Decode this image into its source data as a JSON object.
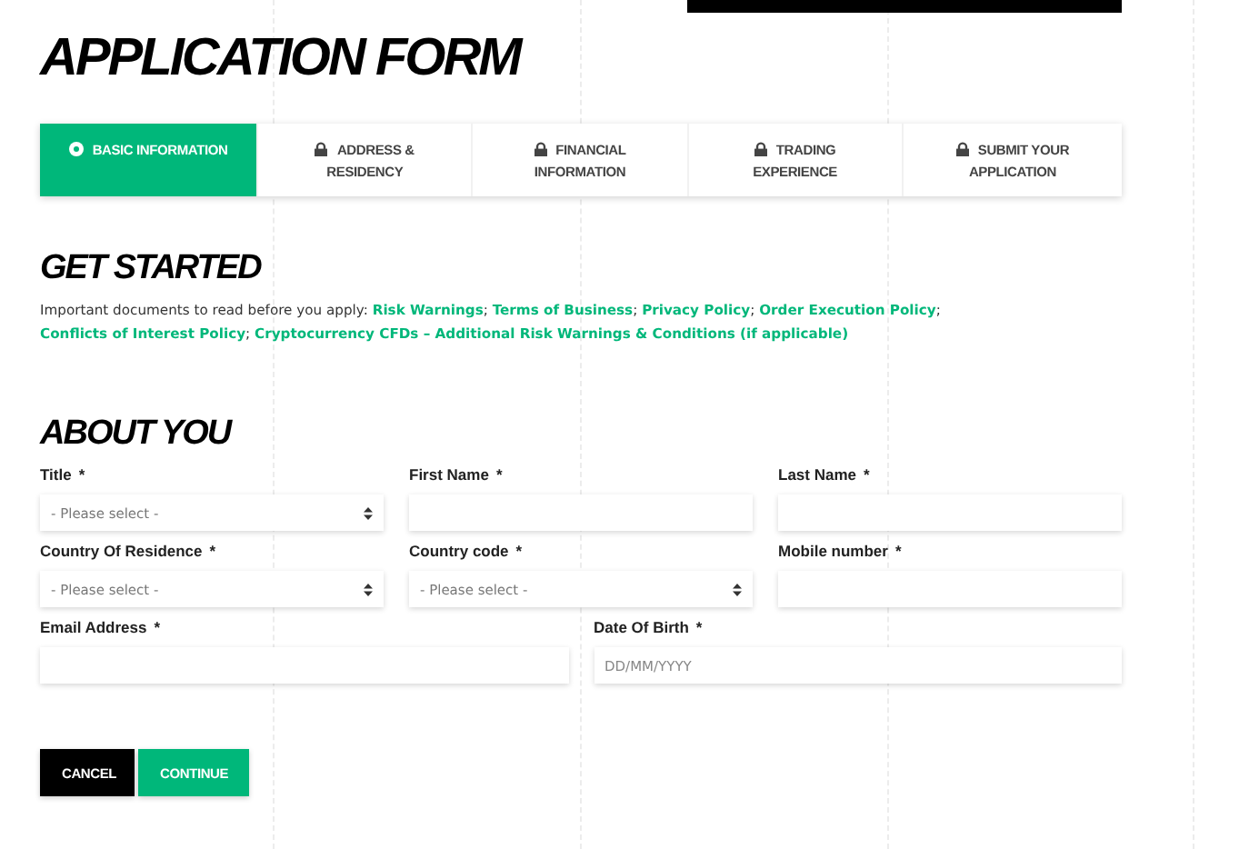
{
  "title": "APPLICATION FORM",
  "tabs": [
    {
      "label": "BASIC INFORMATION",
      "selected": true,
      "locked": false
    },
    {
      "label": "ADDRESS & RESIDENCY",
      "selected": false,
      "locked": true
    },
    {
      "label": "FINANCIAL INFORMATION",
      "selected": false,
      "locked": true
    },
    {
      "label": "TRADING EXPERIENCE",
      "selected": false,
      "locked": true
    },
    {
      "label": "SUBMIT YOUR APPLICATION",
      "selected": false,
      "locked": true
    }
  ],
  "get_started": {
    "heading": "GET STARTED",
    "parts": [
      {
        "kind": "text",
        "text": "Important documents to read before you apply: "
      },
      {
        "kind": "link",
        "text": "Risk Warnings"
      },
      {
        "kind": "text",
        "text": "; "
      },
      {
        "kind": "link",
        "text": "Terms of Business"
      },
      {
        "kind": "text",
        "text": "; "
      },
      {
        "kind": "link",
        "text": "Privacy Policy"
      },
      {
        "kind": "text",
        "text": "; "
      },
      {
        "kind": "link",
        "text": "Order Execution Policy"
      },
      {
        "kind": "text",
        "text": "; "
      },
      {
        "kind": "link",
        "text": "Conflicts of Interest Policy"
      },
      {
        "kind": "text",
        "text": "; "
      },
      {
        "kind": "link",
        "text": "Cryptocurrency CFDs – Additional Risk Warnings & Conditions (if applicable)"
      }
    ]
  },
  "about_you": {
    "heading": "ABOUT YOU",
    "rows": [
      {
        "fields": [
          {
            "kind": "select",
            "label": "Title",
            "mark": "*",
            "placeholder": "- Please select -"
          },
          {
            "kind": "text",
            "label": "First Name",
            "mark": "*"
          },
          {
            "kind": "text",
            "label": "Last Name",
            "mark": "*"
          }
        ]
      },
      {
        "fields": [
          {
            "kind": "select",
            "label": "Country Of Residence",
            "mark": "*",
            "placeholder": "- Please select -"
          },
          {
            "kind": "select",
            "label": "Country code",
            "mark": "*",
            "placeholder": "- Please select -"
          },
          {
            "kind": "text",
            "label": "Mobile number",
            "mark": "*"
          }
        ]
      },
      {
        "fields": [
          {
            "kind": "text",
            "label": "Email Address",
            "mark": "*"
          },
          {
            "kind": "text",
            "label": "Date Of Birth",
            "mark": "*",
            "placeholder": "DD/MM/YYYY"
          }
        ]
      }
    ]
  },
  "buttons": [
    {
      "kind": "secondary",
      "label": "CANCEL"
    },
    {
      "kind": "primary",
      "label": "CONTINUE"
    }
  ]
}
